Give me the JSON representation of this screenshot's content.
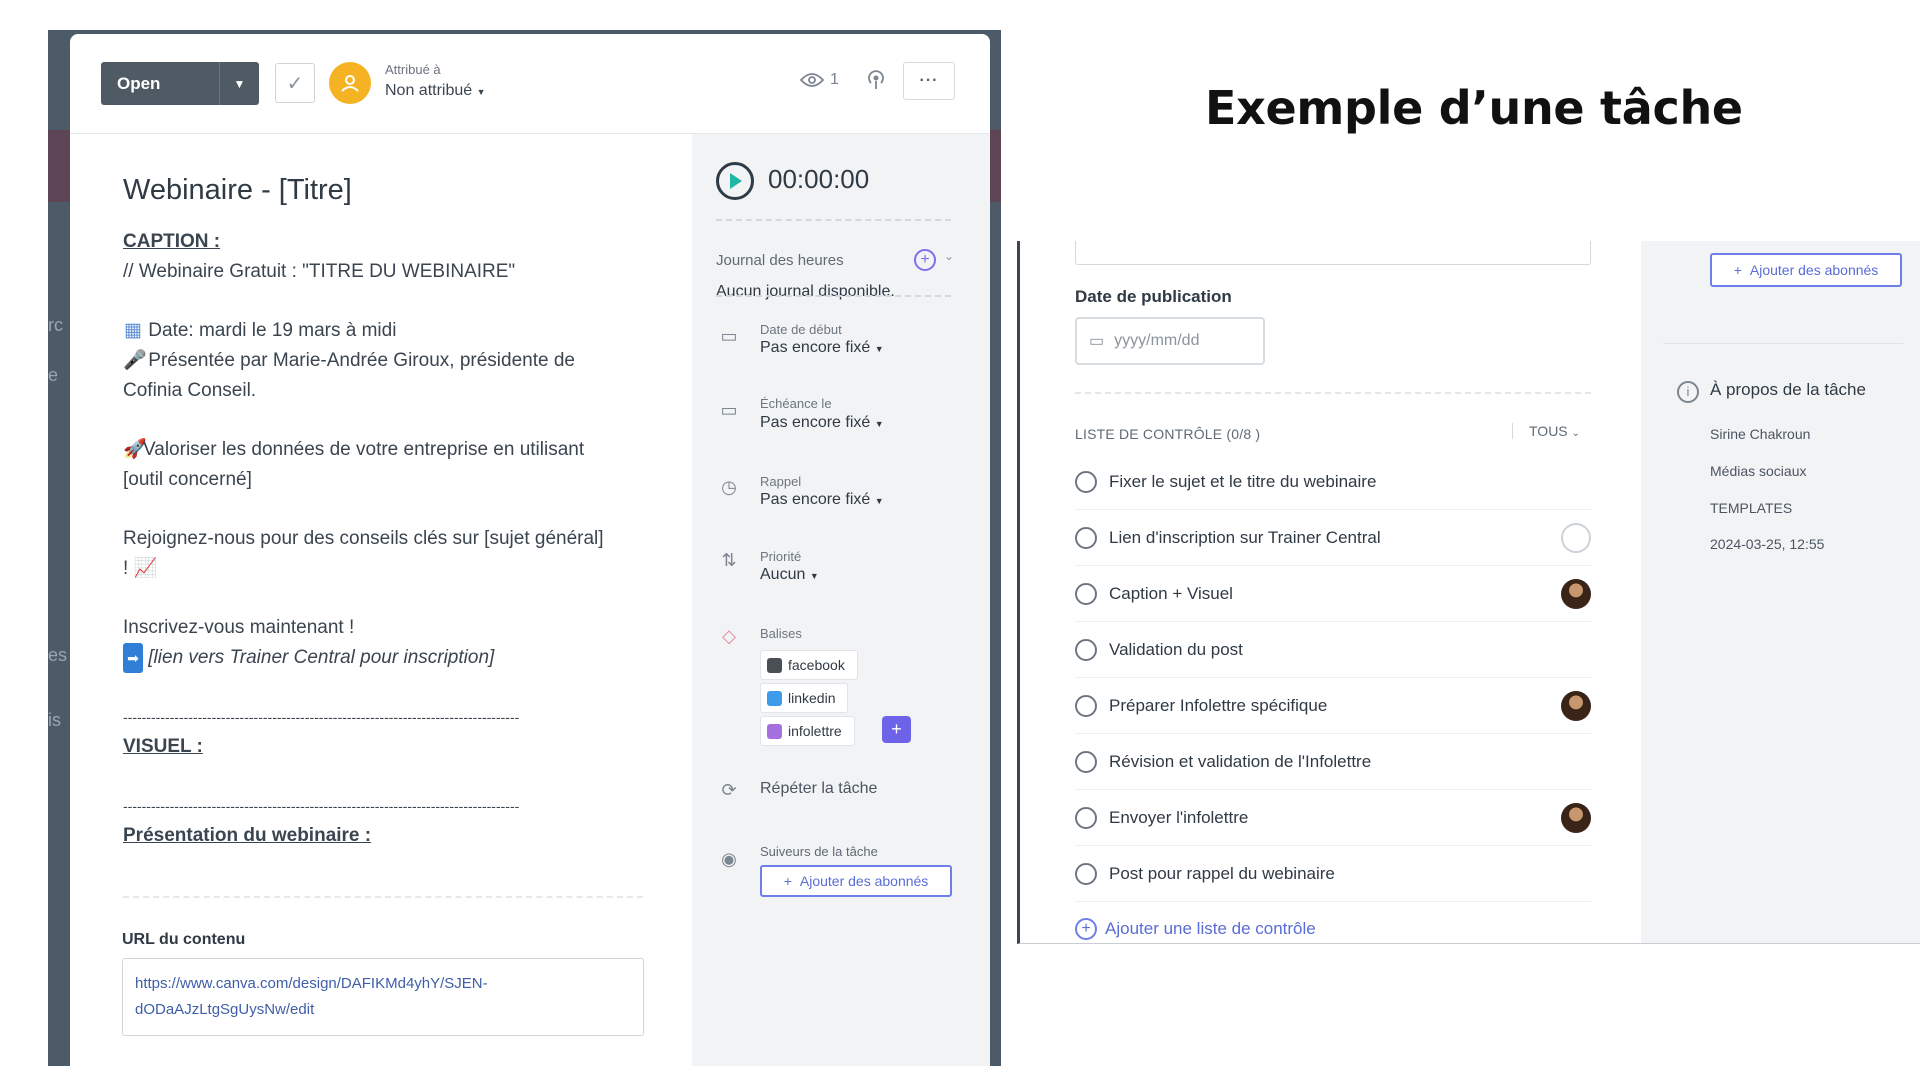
{
  "page_title": "Exemple d’une tâche",
  "task_card": {
    "status": "Open",
    "assigned_label": "Attribué à",
    "assignee": "Non attribué",
    "watcher_count": "1",
    "more_label": "···",
    "title": "Webinaire - [Titre]",
    "description": {
      "caption_head": "CAPTION :",
      "caption_line": "// Webinaire Gratuit : \"TITRE DU WEBINAIRE\"",
      "date_line": "Date: mardi le 19 mars à midi",
      "presenter_line1": "Présentée par Marie-Andrée Giroux, présidente de",
      "presenter_line2": "Cofinia Conseil.",
      "value_line1": "Valoriser les données de votre entreprise en utilisant",
      "value_line2": "[outil concerné]",
      "join_line1": "Rejoignez-nous pour des conseils clés sur [sujet général]",
      "join_line2": "!",
      "signup_line": "Inscrivez-vous maintenant !",
      "link_line": "[lien vers Trainer Central pour inscription]",
      "dash_line": "-------------------------------------------------------------------------------------",
      "visual_head": "VISUEL :",
      "presentation_head": "Présentation du webinaire :"
    },
    "url_label": "URL du contenu",
    "url_line1": "https://www.canva.com/design/DAFIKMd4yhY/SJEN-",
    "url_line2": "dODaAJzLtgSgUysNw/edit",
    "side": {
      "timer": "00:00:00",
      "hours_label": "Journal des heures",
      "hours_empty": "Aucun journal disponible.",
      "start_label": "Date de début",
      "start_value": "Pas encore fixé",
      "due_label": "Échéance le",
      "due_value": "Pas encore fixé",
      "reminder_label": "Rappel",
      "reminder_value": "Pas encore fixé",
      "priority_label": "Priorité",
      "priority_value": "Aucun",
      "tags_label": "Balises",
      "tags": [
        {
          "name": "facebook",
          "color": "#4a4f55"
        },
        {
          "name": "linkedin",
          "color": "#3d9be9"
        },
        {
          "name": "infolettre",
          "color": "#a66fe0"
        }
      ],
      "repeat_label": "Répéter la tâche",
      "followers_label": "Suiveurs de la tâche",
      "add_followers": "Ajouter des abonnés"
    }
  },
  "checklist_view": {
    "pub_label": "Date de publication",
    "pub_placeholder": "yyyy/mm/dd",
    "checklist_header": "LISTE DE CONTRÔLE  (0/8 )",
    "filter": "TOUS",
    "items": [
      {
        "text": "Fixer le sujet et le titre du webinaire",
        "avatar": "none"
      },
      {
        "text": "Lien d'inscription sur Trainer Central",
        "avatar": "empty"
      },
      {
        "text": "Caption + Visuel",
        "avatar": "photo"
      },
      {
        "text": "Validation du post",
        "avatar": "none"
      },
      {
        "text": "Préparer Infolettre spécifique",
        "avatar": "photo"
      },
      {
        "text": "Révision et validation de l'Infolettre",
        "avatar": "none"
      },
      {
        "text": "Envoyer l'infolettre",
        "avatar": "photo"
      },
      {
        "text": "Post pour rappel du webinaire",
        "avatar": "none"
      }
    ],
    "add_checklist": "Ajouter une liste de contrôle",
    "add_followers": "Ajouter des abonnés",
    "about_label": "À propos de la tâche",
    "about": {
      "owner": "Sirine Chakroun",
      "project": "Médias sociaux",
      "list": "TEMPLATES",
      "created": "2024-03-25, 12:55"
    }
  }
}
